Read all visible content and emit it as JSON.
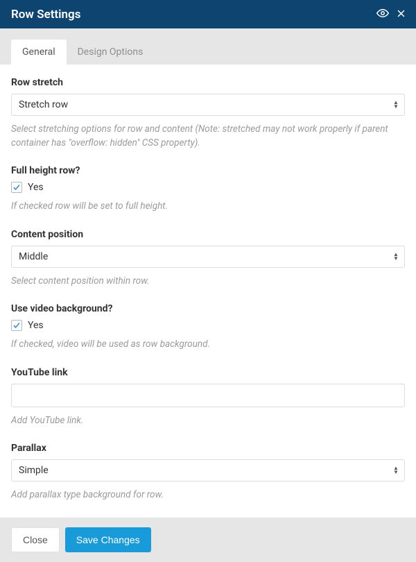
{
  "header": {
    "title": "Row Settings"
  },
  "tabs": {
    "general": "General",
    "design_options": "Design Options"
  },
  "fields": {
    "row_stretch": {
      "label": "Row stretch",
      "value": "Stretch row",
      "hint": "Select stretching options for row and content (Note: stretched may not work properly if parent container has \"overflow: hidden\" CSS property)."
    },
    "full_height": {
      "label": "Full height row?",
      "cb_label": "Yes",
      "hint": "If checked row will be set to full height."
    },
    "content_position": {
      "label": "Content position",
      "value": "Middle",
      "hint": "Select content position within row."
    },
    "video_bg": {
      "label": "Use video background?",
      "cb_label": "Yes",
      "hint": "If checked, video will be used as row background."
    },
    "youtube": {
      "label": "YouTube link",
      "value": "",
      "hint": "Add YouTube link."
    },
    "parallax": {
      "label": "Parallax",
      "value": "Simple",
      "hint": "Add parallax type background for row."
    }
  },
  "footer": {
    "close": "Close",
    "save": "Save Changes"
  }
}
